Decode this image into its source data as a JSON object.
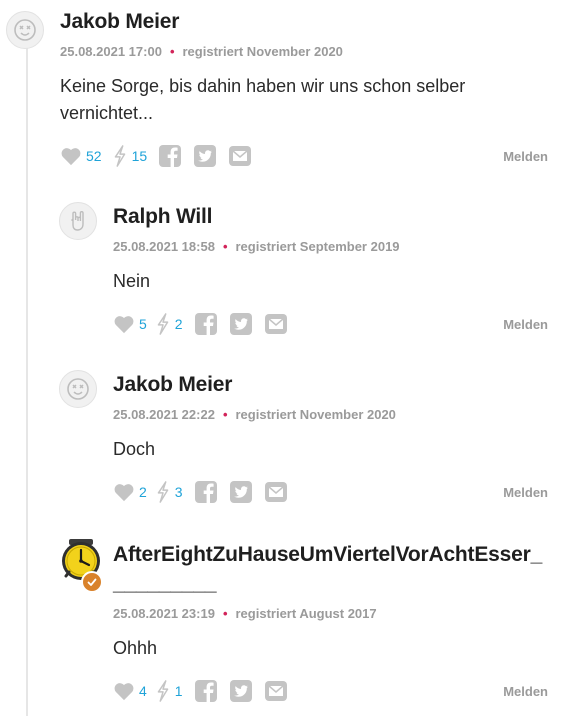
{
  "comments": [
    {
      "author": "Jakob Meier",
      "date": "25.08.2021 17:00",
      "registered": "registriert November 2020",
      "text": "Keine Sorge, bis dahin haben wir uns schon selber vernichtet...",
      "likes": "52",
      "flashes": "15",
      "report_label": "Melden",
      "avatar_icon": "dizzy-face-icon"
    },
    {
      "author": "Ralph Will",
      "date": "25.08.2021 18:58",
      "registered": "registriert September 2019",
      "text": "Nein",
      "likes": "5",
      "flashes": "2",
      "report_label": "Melden",
      "avatar_icon": "rock-hand-icon"
    },
    {
      "author": "Jakob Meier",
      "date": "25.08.2021 22:22",
      "registered": "registriert November 2020",
      "text": "Doch",
      "likes": "2",
      "flashes": "3",
      "report_label": "Melden",
      "avatar_icon": "dizzy-face-icon"
    },
    {
      "author": "AfterEightZuHauseUmViertelVorAchtEsser_",
      "author_line2": "_________",
      "date": "25.08.2021 23:19",
      "registered": "registriert August 2017",
      "text": "Ohhh",
      "likes": "4",
      "flashes": "1",
      "report_label": "Melden",
      "avatar_icon": "clock-icon"
    }
  ],
  "colors": {
    "accent_count": "#1fa3d8",
    "dot": "#d2245a",
    "icon_gray": "#c4c4c4",
    "meta_gray": "#9a9a9a",
    "badge": "#d9822b"
  }
}
